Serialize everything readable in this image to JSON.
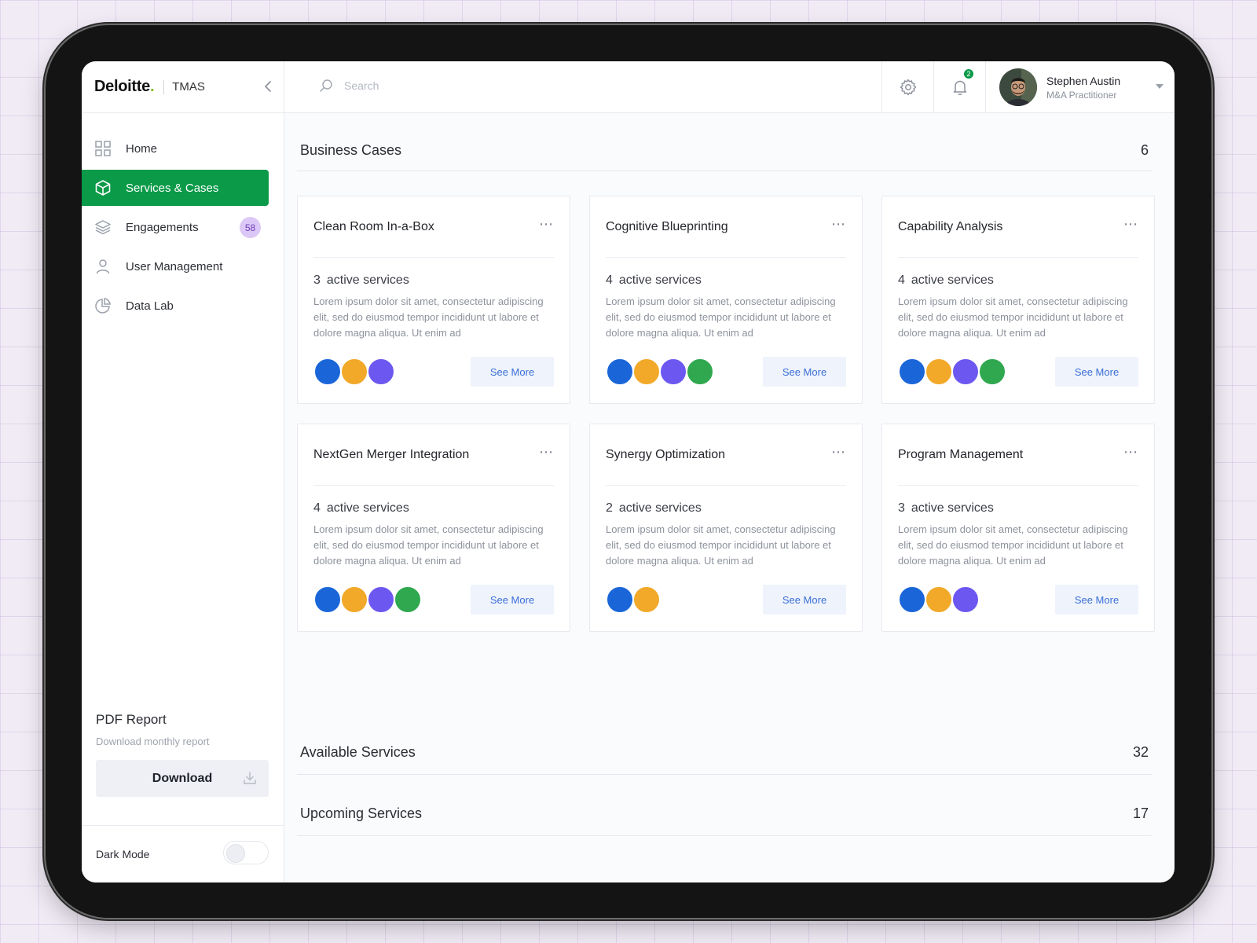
{
  "brand": {
    "logo": "Deloitte",
    "dot": ".",
    "product": "TMAS"
  },
  "search": {
    "placeholder": "Search"
  },
  "notifications": {
    "count": "2"
  },
  "user": {
    "name": "Stephen Austin",
    "role": "M&A Practitioner"
  },
  "sidebar": {
    "items": [
      {
        "label": "Home",
        "icon": "grid-icon",
        "active": false
      },
      {
        "label": "Services & Cases",
        "icon": "box-icon",
        "active": true
      },
      {
        "label": "Engagements",
        "icon": "layers-icon",
        "active": false,
        "badge": "58"
      },
      {
        "label": "User Management",
        "icon": "user-icon",
        "active": false
      },
      {
        "label": "Data Lab",
        "icon": "pie-chart-icon",
        "active": false
      }
    ],
    "pdf": {
      "title": "PDF Report",
      "subtitle": "Download monthly report",
      "button": "Download"
    },
    "dark_mode": {
      "label": "Dark Mode",
      "on": false
    }
  },
  "business_cases": {
    "title": "Business Cases",
    "count": "6",
    "cards": [
      {
        "title": "Clean Room In-a-Box",
        "active_count": "3",
        "active_label": "active services",
        "description": "Lorem ipsum dolor sit amet, consectetur adipiscing elit, sed do eiusmod tempor incididunt ut labore et dolore magna aliqua. Ut enim ad",
        "avatars": [
          "#1a66d9",
          "#f2a929",
          "#6c58f0"
        ],
        "button": "See More"
      },
      {
        "title": "Cognitive Blueprinting",
        "active_count": "4",
        "active_label": "active services",
        "description": "Lorem ipsum dolor sit amet, consectetur adipiscing elit, sed do eiusmod tempor incididunt ut labore et dolore magna aliqua. Ut enim ad",
        "avatars": [
          "#1a66d9",
          "#f2a929",
          "#6c58f0",
          "#2fa84f"
        ],
        "button": "See More"
      },
      {
        "title": "Capability Analysis",
        "active_count": "4",
        "active_label": "active services",
        "description": "Lorem ipsum dolor sit amet, consectetur adipiscing elit, sed do eiusmod tempor incididunt ut labore et dolore magna aliqua. Ut enim ad",
        "avatars": [
          "#1a66d9",
          "#f2a929",
          "#6c58f0",
          "#2fa84f"
        ],
        "button": "See More"
      },
      {
        "title": "NextGen Merger Integration",
        "active_count": "4",
        "active_label": "active services",
        "description": "Lorem ipsum dolor sit amet, consectetur adipiscing elit, sed do eiusmod tempor incididunt ut labore et dolore magna aliqua. Ut enim ad",
        "avatars": [
          "#1a66d9",
          "#f2a929",
          "#6c58f0",
          "#2fa84f"
        ],
        "button": "See More"
      },
      {
        "title": "Synergy Optimization",
        "active_count": "2",
        "active_label": "active services",
        "description": "Lorem ipsum dolor sit amet, consectetur adipiscing elit, sed do eiusmod tempor incididunt ut labore et dolore magna aliqua. Ut enim ad",
        "avatars": [
          "#1a66d9",
          "#f2a929"
        ],
        "button": "See More"
      },
      {
        "title": "Program Management",
        "active_count": "3",
        "active_label": "active services",
        "description": "Lorem ipsum dolor sit amet, consectetur adipiscing elit, sed do eiusmod tempor incididunt ut labore et dolore magna aliqua. Ut enim ad",
        "avatars": [
          "#1a66d9",
          "#f2a929",
          "#6c58f0"
        ],
        "button": "See More"
      }
    ]
  },
  "available_services": {
    "title": "Available Services",
    "count": "32"
  },
  "upcoming_services": {
    "title": "Upcoming Services",
    "count": "17"
  },
  "colors": {
    "accent_green": "#0a9a48",
    "brand_dot": "#86bc25",
    "link_blue": "#3a6fd8"
  }
}
